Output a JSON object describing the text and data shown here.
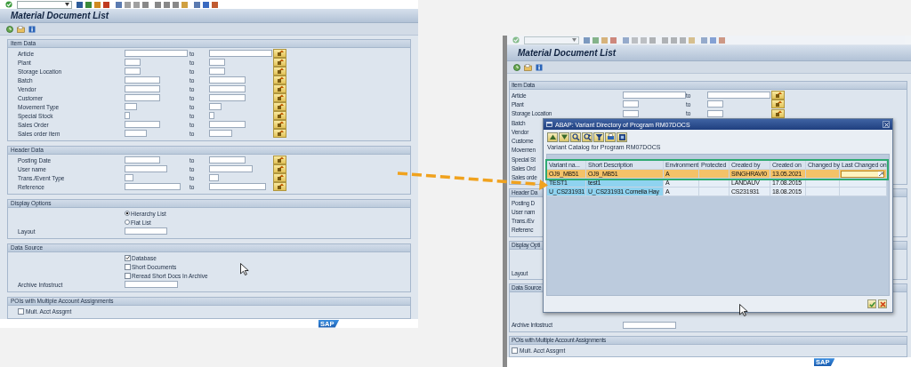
{
  "screens": [
    {
      "title": "Material Document List",
      "logo": "SAP",
      "sections": [
        {
          "title": "Item Data",
          "rows": [
            {
              "kind": "range",
              "label": "Article",
              "to": "to"
            },
            {
              "kind": "range",
              "label": "Plant",
              "to": "to"
            },
            {
              "kind": "range",
              "label": "Storage Location",
              "to": "to"
            },
            {
              "kind": "range",
              "label": "Batch",
              "to": "to"
            },
            {
              "kind": "range",
              "label": "Vendor",
              "to": "to"
            },
            {
              "kind": "range",
              "label": "Customer",
              "to": "to"
            },
            {
              "kind": "range",
              "label": "Movement Type",
              "to": "to"
            },
            {
              "kind": "range",
              "label": "Special Stock",
              "to": "to"
            },
            {
              "kind": "range",
              "label": "Sales Order",
              "to": "to"
            },
            {
              "kind": "range",
              "label": "Sales order item",
              "to": "to"
            }
          ]
        },
        {
          "title": "Header Data",
          "rows": [
            {
              "kind": "range",
              "label": "Posting Date",
              "to": "to"
            },
            {
              "kind": "range",
              "label": "User name",
              "to": "to"
            },
            {
              "kind": "range",
              "label": "Trans./Event Type",
              "to": "to"
            },
            {
              "kind": "range",
              "label": "Reference",
              "to": "to"
            }
          ]
        },
        {
          "title": "Display Options",
          "rows": [
            {
              "kind": "radio",
              "label": "Hierarchy List",
              "selected": true
            },
            {
              "kind": "radio",
              "label": "Flat List",
              "selected": false
            },
            {
              "kind": "field",
              "label": "Layout"
            }
          ]
        },
        {
          "title": "Data Source",
          "rows": [
            {
              "kind": "checkbox",
              "label": "Database",
              "checked": true
            },
            {
              "kind": "checkbox",
              "label": "Short Documents",
              "checked": false
            },
            {
              "kind": "checkbox",
              "label": "Reread Short Docs In Archive",
              "checked": false
            },
            {
              "kind": "field",
              "label": "Archive Infostruct"
            }
          ]
        },
        {
          "title": "POIs with Multiple Account Assignments",
          "rows": [
            {
              "kind": "checkbox_label",
              "label": "Mult. Acct Assgmt",
              "checked": false
            }
          ]
        }
      ]
    },
    {
      "title": "Material Document List",
      "logo": "SAP",
      "sections": [
        {
          "title": "Item Data",
          "rows": [
            {
              "kind": "range",
              "label": "Article",
              "to": "to"
            },
            {
              "kind": "range",
              "label": "Plant",
              "to": "to"
            },
            {
              "kind": "range",
              "label": "Storage Location",
              "to": "to"
            },
            {
              "kind": "label",
              "label": "Batch"
            },
            {
              "kind": "label",
              "label": "Vendor"
            },
            {
              "kind": "label",
              "label": "Custome"
            },
            {
              "kind": "label",
              "label": "Movemen"
            },
            {
              "kind": "label",
              "label": "Special St"
            },
            {
              "kind": "label",
              "label": "Sales Ord"
            },
            {
              "kind": "label",
              "label": "Sales orde"
            }
          ]
        },
        {
          "title": "Header Da",
          "rows": [
            {
              "kind": "label",
              "label": "Posting D"
            },
            {
              "kind": "label",
              "label": "User nam"
            },
            {
              "kind": "label",
              "label": "Trans./Ev"
            },
            {
              "kind": "label",
              "label": "Referenc"
            }
          ]
        },
        {
          "title": "Display Opti",
          "rows": [
            {
              "kind": "covered"
            },
            {
              "kind": "covered"
            },
            {
              "kind": "label",
              "label": "Layout"
            }
          ]
        },
        {
          "title": "Data Source",
          "rows": [
            {
              "kind": "covered"
            },
            {
              "kind": "covered"
            },
            {
              "kind": "covered"
            },
            {
              "kind": "field",
              "label": "Archive Infostruct"
            }
          ]
        },
        {
          "title": "POIs with Multiple Account Assignments",
          "rows": [
            {
              "kind": "checkbox_label",
              "label": "Mult. Acct Assgmt",
              "checked": false
            }
          ]
        }
      ]
    }
  ],
  "dialog": {
    "title": "ABAP: Variant Directory of Program RM07DOCS",
    "caption": "Variant Catalog for Program RM07DOCS",
    "columns": [
      "Variant na...",
      "Short Description",
      "Environment",
      "Protected",
      "Created by",
      "Created on",
      "Changed by",
      "Last Changed on"
    ],
    "rows": [
      {
        "cells": [
          "OJ9_MB51",
          "OJ9_MB51",
          "A",
          null,
          "SINGHRAVI0",
          "13.05.2021",
          null,
          null
        ],
        "selected": true,
        "editing": true
      },
      {
        "cells": [
          "TEST1",
          "test1",
          "A",
          null,
          "LANDAUV",
          "17.08.2015",
          null,
          null
        ],
        "selected": false,
        "editing": false
      },
      {
        "cells": [
          "U_CS231931",
          "U_CS231931 Cornelia Hay",
          "A",
          null,
          "CS231931",
          "18.08.2015",
          null,
          null
        ],
        "selected": false,
        "editing": false
      }
    ]
  }
}
